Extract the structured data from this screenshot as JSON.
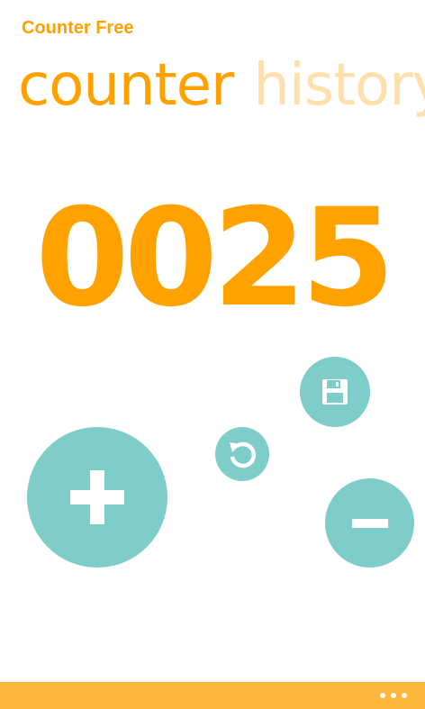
{
  "app": {
    "title": "Counter Free"
  },
  "pivot": {
    "tabs": [
      {
        "label": "counter",
        "selected": true
      },
      {
        "label": "history",
        "selected": false
      }
    ]
  },
  "counter": {
    "value": "0025"
  },
  "controls": {
    "increment_icon": "plus-icon",
    "decrement_icon": "minus-icon",
    "save_icon": "floppy-disk-icon",
    "reset_icon": "refresh-icon"
  },
  "app_bar": {
    "more_icon": "ellipsis-icon"
  },
  "colors": {
    "accent": "#ffa200",
    "accent_faded": "#ffe0ac",
    "button": "#7ecdc8",
    "app_bar": "#fdb73b",
    "background": "#ffffff"
  }
}
